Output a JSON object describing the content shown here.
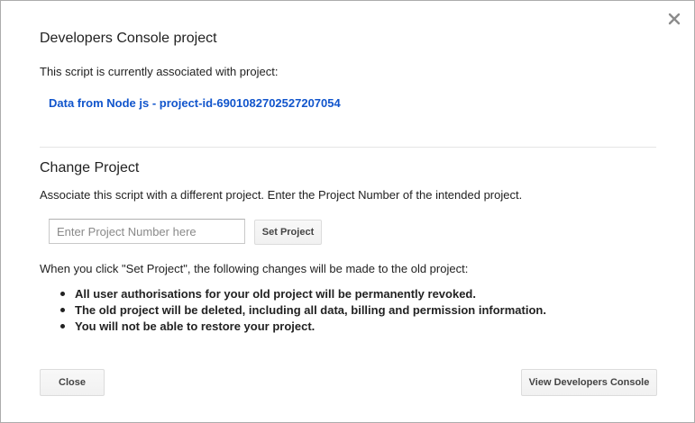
{
  "dialog": {
    "title": "Developers Console project",
    "association_text": "This script is currently associated with project:",
    "project_link": "Data from Node js - project-id-6901082702527207054",
    "close_icon": "close-icon"
  },
  "change_project": {
    "title": "Change Project",
    "description": "Associate this script with a different project. Enter the Project Number of the intended project.",
    "input_placeholder": "Enter Project Number here",
    "input_value": "",
    "set_button_label": "Set Project"
  },
  "warning": {
    "intro": "When you click \"Set Project\", the following changes will be made to the old project:",
    "items": [
      "All user authorisations for your old project will be permanently revoked.",
      "The old project will be deleted, including all data, billing and permission information.",
      "You will not be able to restore your project."
    ]
  },
  "footer": {
    "close_label": "Close",
    "view_console_label": "View Developers Console"
  },
  "colors": {
    "link": "#1155cc",
    "text": "#222222",
    "divider": "#e5e5e5",
    "button_border": "#dcdcdc"
  }
}
